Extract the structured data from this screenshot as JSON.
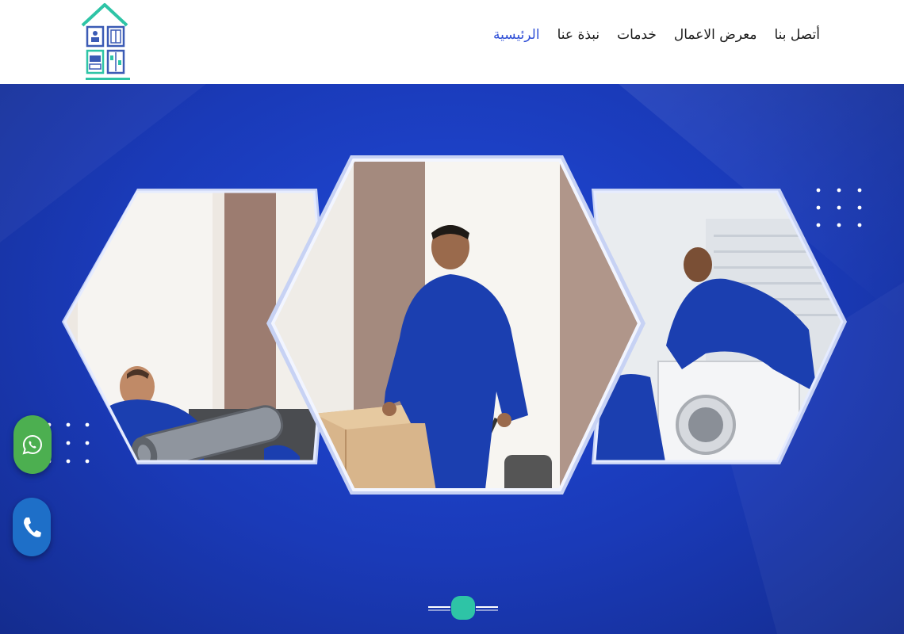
{
  "nav": {
    "items": [
      {
        "label": "الرئيسية",
        "active": true
      },
      {
        "label": "نبذة عنا",
        "active": false
      },
      {
        "label": "خدمات",
        "active": false
      },
      {
        "label": "معرض الاعمال",
        "active": false
      },
      {
        "label": "أتصل بنا",
        "active": false
      }
    ]
  },
  "hero": {
    "slides": [
      {
        "image": "movers-carrying-rolled-carpet"
      },
      {
        "image": "mover-pushing-hand-truck-with-boxes"
      },
      {
        "image": "movers-wrapping-washing-machine"
      }
    ],
    "active_slide": 1
  },
  "floating": {
    "whatsapp_icon": "whatsapp-icon",
    "phone_icon": "phone-icon"
  },
  "colors": {
    "brand_blue": "#1f49d8",
    "accent_teal": "#2ec4a6",
    "nav_active": "#2f4fd6",
    "whatsapp_green": "#4caf50",
    "phone_blue": "#1e6fc8"
  }
}
